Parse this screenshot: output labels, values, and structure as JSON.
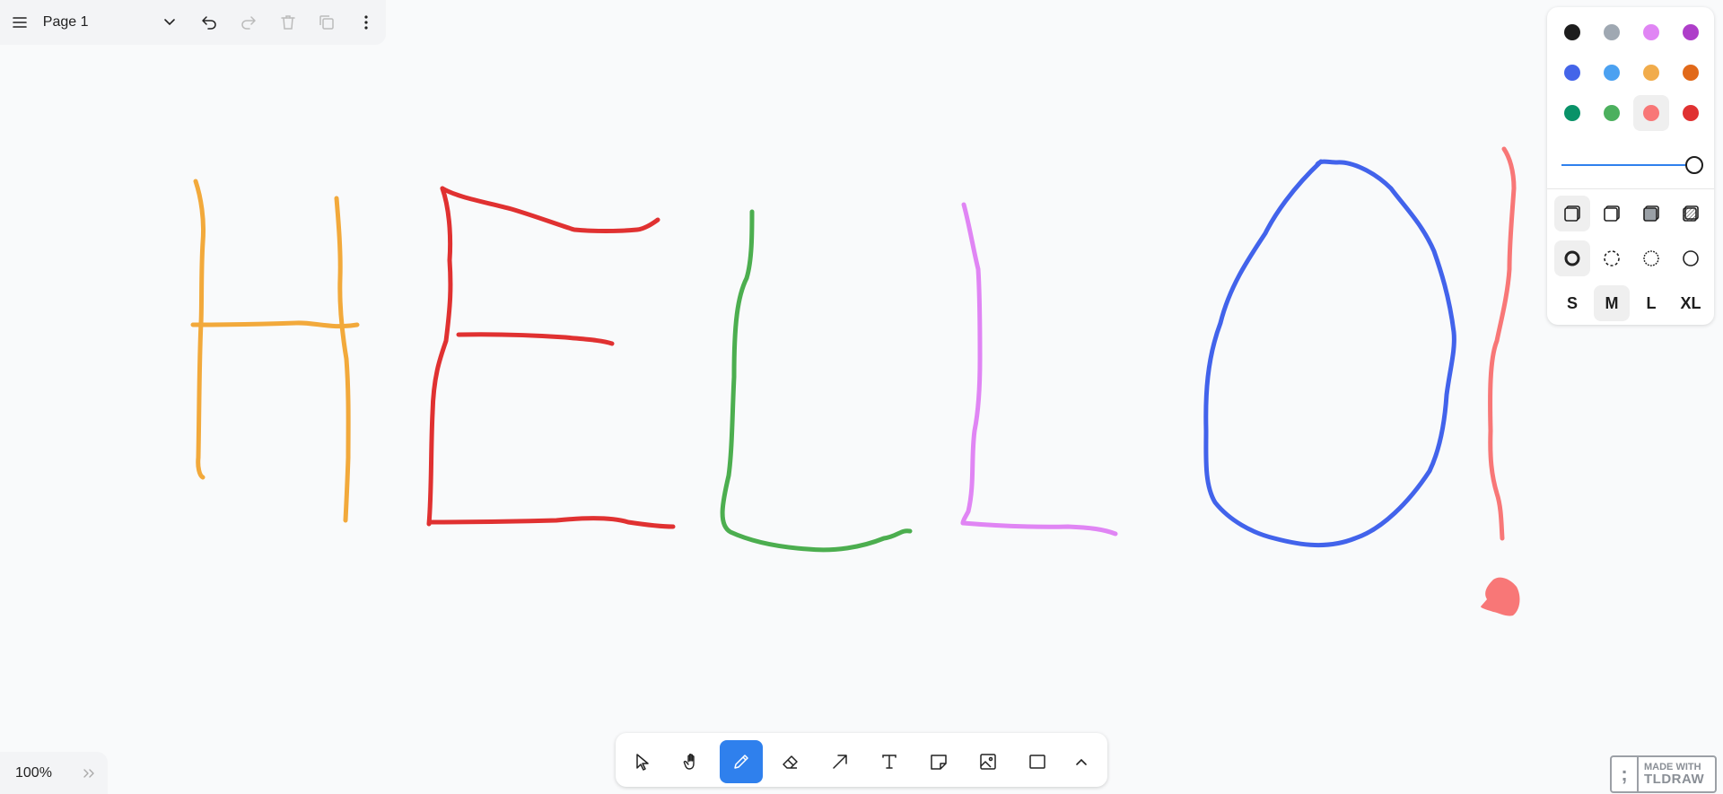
{
  "app": {
    "name": "tldraw"
  },
  "menu": {
    "page_name": "Page 1",
    "icons": [
      "hamburger-menu-icon",
      "chevron-down-icon",
      "undo-icon",
      "redo-icon",
      "trash-icon",
      "duplicate-icon",
      "more-vertical-icon"
    ]
  },
  "canvas": {
    "strokes": [
      {
        "letter": "H",
        "color": "#f2a93b"
      },
      {
        "letter": "E",
        "color": "#e03131"
      },
      {
        "letter": "L",
        "color": "#4cae4f"
      },
      {
        "letter": "L",
        "color": "#e085f4"
      },
      {
        "letter": "O",
        "color": "#4263eb"
      },
      {
        "letter": "!",
        "color": "#f87777"
      }
    ]
  },
  "style_panel": {
    "colors": [
      {
        "name": "black",
        "hex": "#1d1d1d"
      },
      {
        "name": "grey",
        "hex": "#9fa8b2"
      },
      {
        "name": "light-violet",
        "hex": "#e085f4"
      },
      {
        "name": "violet",
        "hex": "#ae3ec9"
      },
      {
        "name": "blue",
        "hex": "#4465e9"
      },
      {
        "name": "light-blue",
        "hex": "#4ba1f1"
      },
      {
        "name": "yellow",
        "hex": "#f1ac4b"
      },
      {
        "name": "orange",
        "hex": "#e16919"
      },
      {
        "name": "green",
        "hex": "#099268"
      },
      {
        "name": "light-green",
        "hex": "#4cb05e"
      },
      {
        "name": "light-red",
        "hex": "#f87777"
      },
      {
        "name": "red",
        "hex": "#e03131"
      }
    ],
    "selected_color": "light-red",
    "opacity": 1.0,
    "fill_options": [
      "fill-none-icon",
      "fill-semi-icon",
      "fill-solid-icon",
      "fill-pattern-icon"
    ],
    "selected_fill": "fill-none-icon",
    "dash_options": [
      "dash-draw-icon",
      "dash-dashed-icon",
      "dash-dotted-icon",
      "dash-solid-icon"
    ],
    "selected_dash": "dash-draw-icon",
    "sizes": [
      "S",
      "M",
      "L",
      "XL"
    ],
    "selected_size": "M"
  },
  "toolbar": {
    "tools": [
      "select-icon",
      "hand-icon",
      "draw-icon",
      "eraser-icon",
      "arrow-icon",
      "text-icon",
      "note-icon",
      "image-icon",
      "rectangle-icon",
      "chevron-up-icon"
    ],
    "active_tool": "draw-icon"
  },
  "zoom": {
    "value": "100%"
  },
  "badge": {
    "line1": "MADE WITH",
    "line2": "TLDRAW"
  },
  "colors": {
    "accent": "#2f80ed",
    "canvas_bg": "#f9fafb",
    "panel_bg": "#f3f4f6"
  }
}
